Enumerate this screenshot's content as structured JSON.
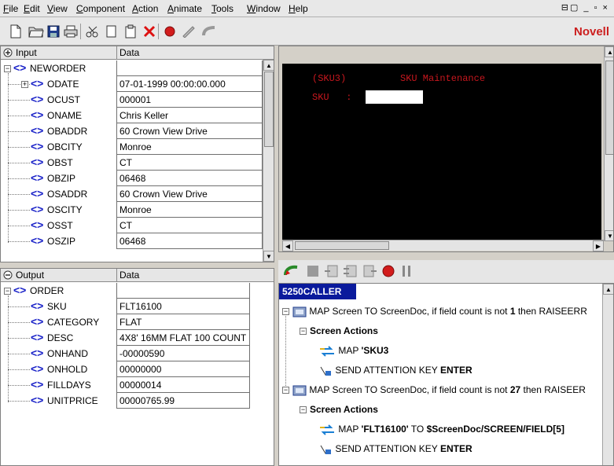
{
  "menu": [
    "File",
    "Edit",
    "View",
    "Component",
    "Action",
    "Animate",
    "Tools",
    "Window",
    "Help"
  ],
  "window_controls": "⊟▢ _ ▫ ×",
  "brand": "Novell",
  "input_pane": {
    "header_col1": "Input",
    "header_col2": "Data",
    "root": "NEWORDER",
    "rows": [
      {
        "name": "ODATE",
        "value": "07-01-1999 00:00:00.000",
        "expandable": true
      },
      {
        "name": "OCUST",
        "value": "000001"
      },
      {
        "name": "ONAME",
        "value": "Chris Keller"
      },
      {
        "name": "OBADDR",
        "value": "60 Crown View Drive"
      },
      {
        "name": "OBCITY",
        "value": "Monroe"
      },
      {
        "name": "OBST",
        "value": "CT"
      },
      {
        "name": "OBZIP",
        "value": "06468"
      },
      {
        "name": "OSADDR",
        "value": "60 Crown View Drive"
      },
      {
        "name": "OSCITY",
        "value": "Monroe"
      },
      {
        "name": "OSST",
        "value": "CT"
      },
      {
        "name": "OSZIP",
        "value": "06468"
      }
    ]
  },
  "output_pane": {
    "header_col1": "Output",
    "header_col2": "Data",
    "root": "ORDER",
    "rows": [
      {
        "name": "SKU",
        "value": "FLT16100"
      },
      {
        "name": "CATEGORY",
        "value": "FLAT"
      },
      {
        "name": "DESC",
        "value": "4X8' 16MM FLAT 100 COUNT"
      },
      {
        "name": "ONHAND",
        "value": "-00000590"
      },
      {
        "name": "ONHOLD",
        "value": "00000000"
      },
      {
        "name": "FILLDAYS",
        "value": "00000014"
      },
      {
        "name": "UNITPRICE",
        "value": "00000765.99"
      }
    ]
  },
  "terminal": {
    "screen_id": "(SKU3)",
    "screen_title": "SKU Maintenance",
    "field_label": "SKU   :"
  },
  "actions": {
    "title": "5250CALLER",
    "items": [
      {
        "kind": "map",
        "pre": "MAP Screen TO ScreenDoc, if field count is not ",
        "num": "1",
        "post": " then RAISEERR"
      },
      {
        "kind": "group",
        "label": "Screen Actions"
      },
      {
        "kind": "mapfield",
        "pre": "MAP ",
        "bold": "'SKU3",
        "post": ""
      },
      {
        "kind": "key",
        "pre": "SEND ATTENTION KEY ",
        "bold": "ENTER"
      },
      {
        "kind": "map",
        "pre": "MAP Screen TO ScreenDoc, if field count is not ",
        "num": "27",
        "post": " then RAISEER"
      },
      {
        "kind": "group",
        "label": "Screen Actions"
      },
      {
        "kind": "mapfield",
        "pre": "MAP ",
        "bold": "'FLT16100'",
        "post": " TO ",
        "bold2": "$ScreenDoc/SCREEN/FIELD[5]"
      },
      {
        "kind": "key",
        "pre": "SEND ATTENTION KEY ",
        "bold": "ENTER"
      }
    ]
  },
  "colors": {
    "accent": "#0a1a9c",
    "tag": "#1a22c8",
    "brand": "#cc1f1f",
    "terminal_text": "#c8171e"
  }
}
